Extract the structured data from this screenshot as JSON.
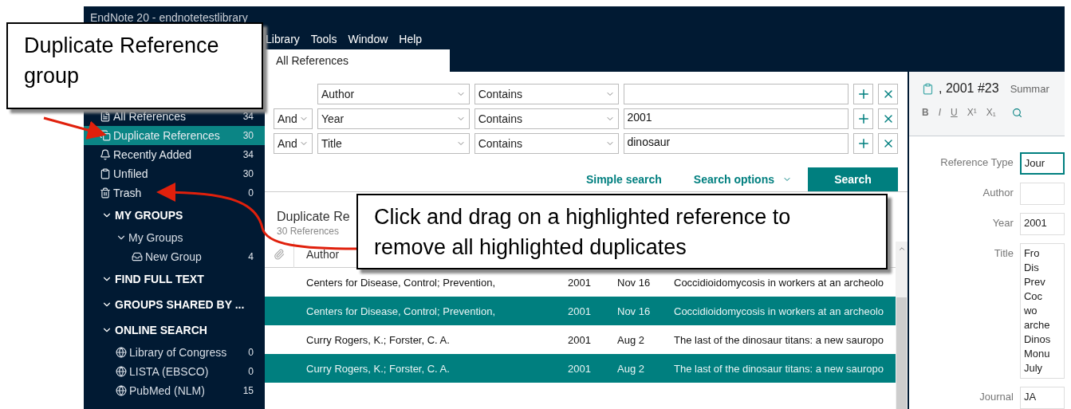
{
  "window": {
    "title": "EndNote 20 - endnotetestlibrary"
  },
  "menu": [
    "Library",
    "Tools",
    "Window",
    "Help"
  ],
  "tabs": [
    {
      "label": "All References",
      "selected": true
    }
  ],
  "sidebar": {
    "items": [
      {
        "label": "All References",
        "count": "34",
        "selected": false
      },
      {
        "label": "Duplicate References",
        "count": "30",
        "selected": true
      },
      {
        "label": "Recently Added",
        "count": "34",
        "selected": false
      },
      {
        "label": "Unfiled",
        "count": "30",
        "selected": false
      },
      {
        "label": "Trash",
        "count": "0",
        "selected": false
      }
    ],
    "sections": [
      {
        "label": "MY GROUPS",
        "expanded": true,
        "children": [
          {
            "label": "My Groups",
            "expanded": true,
            "children": [
              {
                "label": "New Group",
                "count": "4"
              }
            ]
          }
        ]
      },
      {
        "label": "FIND FULL TEXT",
        "expanded": true
      },
      {
        "label": "GROUPS SHARED BY ...",
        "expanded": true
      },
      {
        "label": "ONLINE SEARCH",
        "expanded": true,
        "children": [
          {
            "label": "Library of Congress",
            "count": "0"
          },
          {
            "label": "LISTA (EBSCO)",
            "count": "0"
          },
          {
            "label": "PubMed (NLM)",
            "count": "15"
          }
        ]
      }
    ]
  },
  "search": {
    "rows": [
      {
        "field": "Author",
        "operator": "Contains"
      },
      {
        "connector": "And",
        "field": "Year",
        "operator": "Contains",
        "value": "2001"
      },
      {
        "connector": "And",
        "field": "Title",
        "operator": "Contains",
        "value": "dinosaur"
      }
    ],
    "simple_link": "Simple search",
    "options_link": "Search options",
    "button": "Search"
  },
  "list": {
    "title": "Duplicate Re",
    "subtitle": "30 References"
  },
  "table": {
    "columns": [
      "Author"
    ],
    "rows": [
      {
        "author": "Centers for Disease, Control; Prevention,",
        "year": "2001",
        "date": "Nov 16",
        "title": "Coccidioidomycosis in workers at an archeolo",
        "selected": false
      },
      {
        "author": "Centers for Disease, Control; Prevention,",
        "year": "2001",
        "date": "Nov 16",
        "title": "Coccidioidomycosis in workers at an archeolo",
        "selected": true
      },
      {
        "author": "Curry Rogers, K.; Forster, C. A.",
        "year": "2001",
        "date": "Aug 2",
        "title": "The last of the dinosaur titans: a new sauropo",
        "selected": false
      },
      {
        "author": "Curry Rogers, K.; Forster, C. A.",
        "year": "2001",
        "date": "Aug 2",
        "title": "The last of the dinosaur titans: a new sauropo",
        "selected": true
      }
    ]
  },
  "reference": {
    "heading": ", 2001 #23",
    "tab": "Summar",
    "format": [
      "B",
      "I",
      "U",
      "X¹",
      "X₁"
    ],
    "fields": [
      {
        "label": "Reference Type",
        "lines": [
          "Jour"
        ],
        "focused": true
      },
      {
        "label": "Author",
        "focused": false
      },
      {
        "label": "Year",
        "lines": [
          "2001"
        ],
        "focused": false
      },
      {
        "label": "Title",
        "lines": [
          "Fro",
          "Dis",
          "Prev",
          "Coc",
          "wo",
          "arche",
          "Dinos",
          "Monu",
          "July"
        ],
        "focused": false
      },
      {
        "label": "Journal",
        "lines": [
          "JA"
        ],
        "focused": false
      }
    ]
  },
  "callouts": [
    {
      "text": "Duplicate Reference group"
    },
    {
      "text": "Click and drag on a highlighted reference to remove all highlighted duplicates"
    }
  ]
}
